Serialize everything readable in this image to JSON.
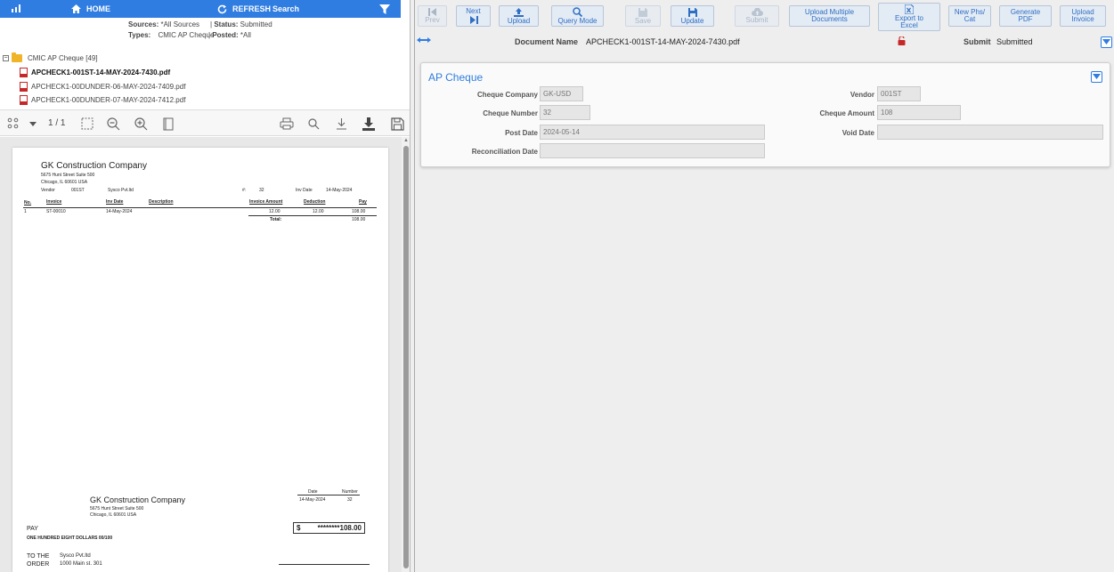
{
  "topbar": {
    "home_label": "HOME",
    "refresh_label": "REFRESH",
    "search_label": "Search"
  },
  "filters": {
    "sources_label": "Sources:",
    "sources_value": "*All Sources",
    "status_label": "Status:",
    "status_value": "Submitted",
    "types_label": "Types:",
    "types_value": "CMIC AP Cheque",
    "posted_label": "Posted:",
    "posted_value": "*All"
  },
  "tree": {
    "root_label": "CMIC AP Cheque [49]",
    "files": [
      "APCHECK1-001ST-14-MAY-2024-7430.pdf",
      "APCHECK1-00DUNDER-06-MAY-2024-7409.pdf",
      "APCHECK1-00DUNDER-07-MAY-2024-7412.pdf"
    ]
  },
  "pdf_viewer": {
    "page_info": "1 / 1"
  },
  "document": {
    "company": "GK Construction Company",
    "address1": "5675 Hunt Street Suite 500",
    "address2": "Chicago, IL 60601 USA",
    "vendor_label": "Vendor",
    "vendor_code": "001ST",
    "vendor_name": "Sysco Pvt.ltd",
    "num_label": "#:",
    "num_value": "32",
    "inv_date_label": "Inv Date",
    "inv_date_value": "14-May-2024",
    "table_headers": [
      "No.",
      "Invoice",
      "Inv Date",
      "Description",
      "Invoice Amount",
      "Deduction",
      "Pay"
    ],
    "row": [
      "1",
      "ST-00010",
      "14-May-2024",
      "",
      "12.00",
      "12.00",
      "108.00"
    ],
    "total_label": "Total:",
    "total_value": "108.00",
    "stub_company": "GK Construction Company",
    "stub_address1": "5675 Hunt Street Suite 500",
    "stub_address2": "Chicago, IL 60601 USA",
    "date_label": "Date",
    "number_label": "Number",
    "date_value": "14-May-2024",
    "number_value": "32",
    "pay_label": "PAY",
    "amount_words": "ONE HUNDRED EIGHT DOLLARS 00/100",
    "dollar_sign": "$",
    "amount_box": "********108.00",
    "to_the": "TO THE",
    "order": "ORDER",
    "payee_name": "Sysco Pvt.ltd",
    "payee_address": "1000 Main st. 301"
  },
  "toolbar": {
    "prev": "Prev",
    "next": "Next",
    "upload": "Upload",
    "query_mode": "Query Mode",
    "save": "Save",
    "update": "Update",
    "submit": "Submit",
    "upload_multiple_1": "Upload Multiple",
    "upload_multiple_2": "Documents",
    "export_1": "Export to",
    "export_2": "Excel",
    "new_phs_1": "New Phs/",
    "new_phs_2": "Cat",
    "generate_1": "Generate",
    "generate_2": "PDF",
    "upload_invoice_1": "Upload",
    "upload_invoice_2": "Invoice"
  },
  "docbar": {
    "doc_name_label": "Document Name",
    "doc_name_value": "APCHECK1-001ST-14-MAY-2024-7430.pdf",
    "submit_label": "Submit",
    "submit_value": "Submitted"
  },
  "form": {
    "title": "AP Cheque",
    "cheque_company_label": "Cheque Company",
    "cheque_company_value": "GK-USD",
    "cheque_number_label": "Cheque Number",
    "cheque_number_value": "32",
    "post_date_label": "Post Date",
    "post_date_value": "2024-05-14",
    "reconciliation_date_label": "Reconciliation Date",
    "reconciliation_date_value": "",
    "vendor_label": "Vendor",
    "vendor_value": "001ST",
    "cheque_amount_label": "Cheque Amount",
    "cheque_amount_value": "108",
    "void_date_label": "Void Date",
    "void_date_value": ""
  },
  "colors": {
    "accent": "#2f7de1",
    "toolbar_button": "#e3ebf5",
    "pdf_red": "#c62828"
  }
}
